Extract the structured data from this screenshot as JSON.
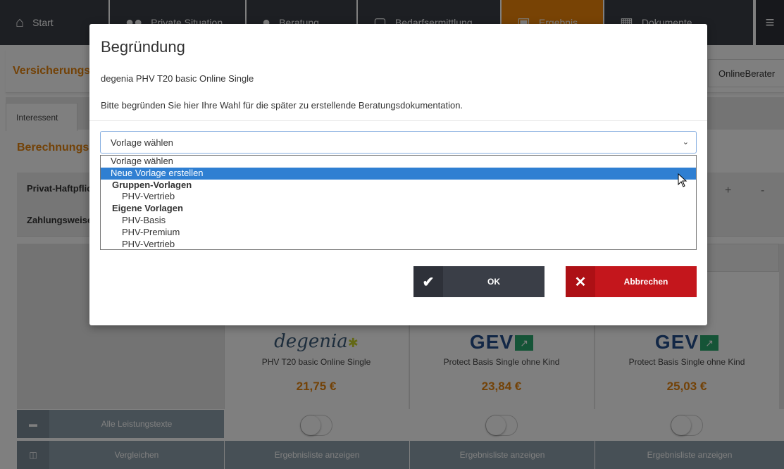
{
  "nav": {
    "items": [
      {
        "label": "Start",
        "icon": "home-icon"
      },
      {
        "label": "Private Situation",
        "icon": "people-icon"
      },
      {
        "label": "Beratung",
        "icon": "speech-bubble-icon"
      },
      {
        "label": "Bedarfsermittlung",
        "icon": "monitor-icon"
      },
      {
        "label": "Ergebnis",
        "icon": "clipboard-icon"
      },
      {
        "label": "Dokumente",
        "icon": "books-icon"
      }
    ],
    "active_index": 4,
    "menu_icon": "hamburger-icon"
  },
  "page": {
    "title": "Versicherungs",
    "advisor": "OnlineBerater",
    "tab": "Interessent",
    "section_title": "Berechnungs",
    "rows": [
      {
        "label": "Privat-Haftpflicht"
      },
      {
        "label": "Zahlungsweise"
      }
    ],
    "plus_label": "+",
    "minus_label": "-"
  },
  "products": [
    {
      "logo": "degenia",
      "name": "PHV T20 basic Online Single",
      "price": "21,75 €"
    },
    {
      "logo": "GEV",
      "name": "Protect Basis Single ohne Kind",
      "price": "23,84 €"
    },
    {
      "logo": "GEV",
      "name": "Protect Basis Single ohne Kind",
      "price": "25,03 €"
    }
  ],
  "bars": {
    "all_texts": "Alle Leistungstexte",
    "compare": "Vergleichen",
    "show_list": "Ergebnisliste anzeigen"
  },
  "modal": {
    "title": "Begründung",
    "product": "degenia PHV T20 basic Online Single",
    "instruction": "Bitte begründen Sie hier Ihre Wahl für die später zu erstellende Beratungsdokumentation.",
    "select_value": "Vorlage wählen",
    "options": [
      {
        "label": "Vorlage wählen",
        "kind": "option"
      },
      {
        "label": "Neue Vorlage erstellen",
        "kind": "option",
        "selected": true
      },
      {
        "label": "Gruppen-Vorlagen",
        "kind": "group"
      },
      {
        "label": "PHV-Vertrieb",
        "kind": "indent"
      },
      {
        "label": "Eigene Vorlagen",
        "kind": "group"
      },
      {
        "label": "PHV-Basis",
        "kind": "indent"
      },
      {
        "label": "PHV-Premium",
        "kind": "indent"
      },
      {
        "label": "PHV-Vertrieb",
        "kind": "indent"
      }
    ],
    "ok_label": "OK",
    "cancel_label": "Abbrechen"
  },
  "colors": {
    "accent": "#f0870a",
    "nav_bg": "#3a3e47",
    "selected_option": "#2f7fd2",
    "cancel": "#c4161c"
  }
}
